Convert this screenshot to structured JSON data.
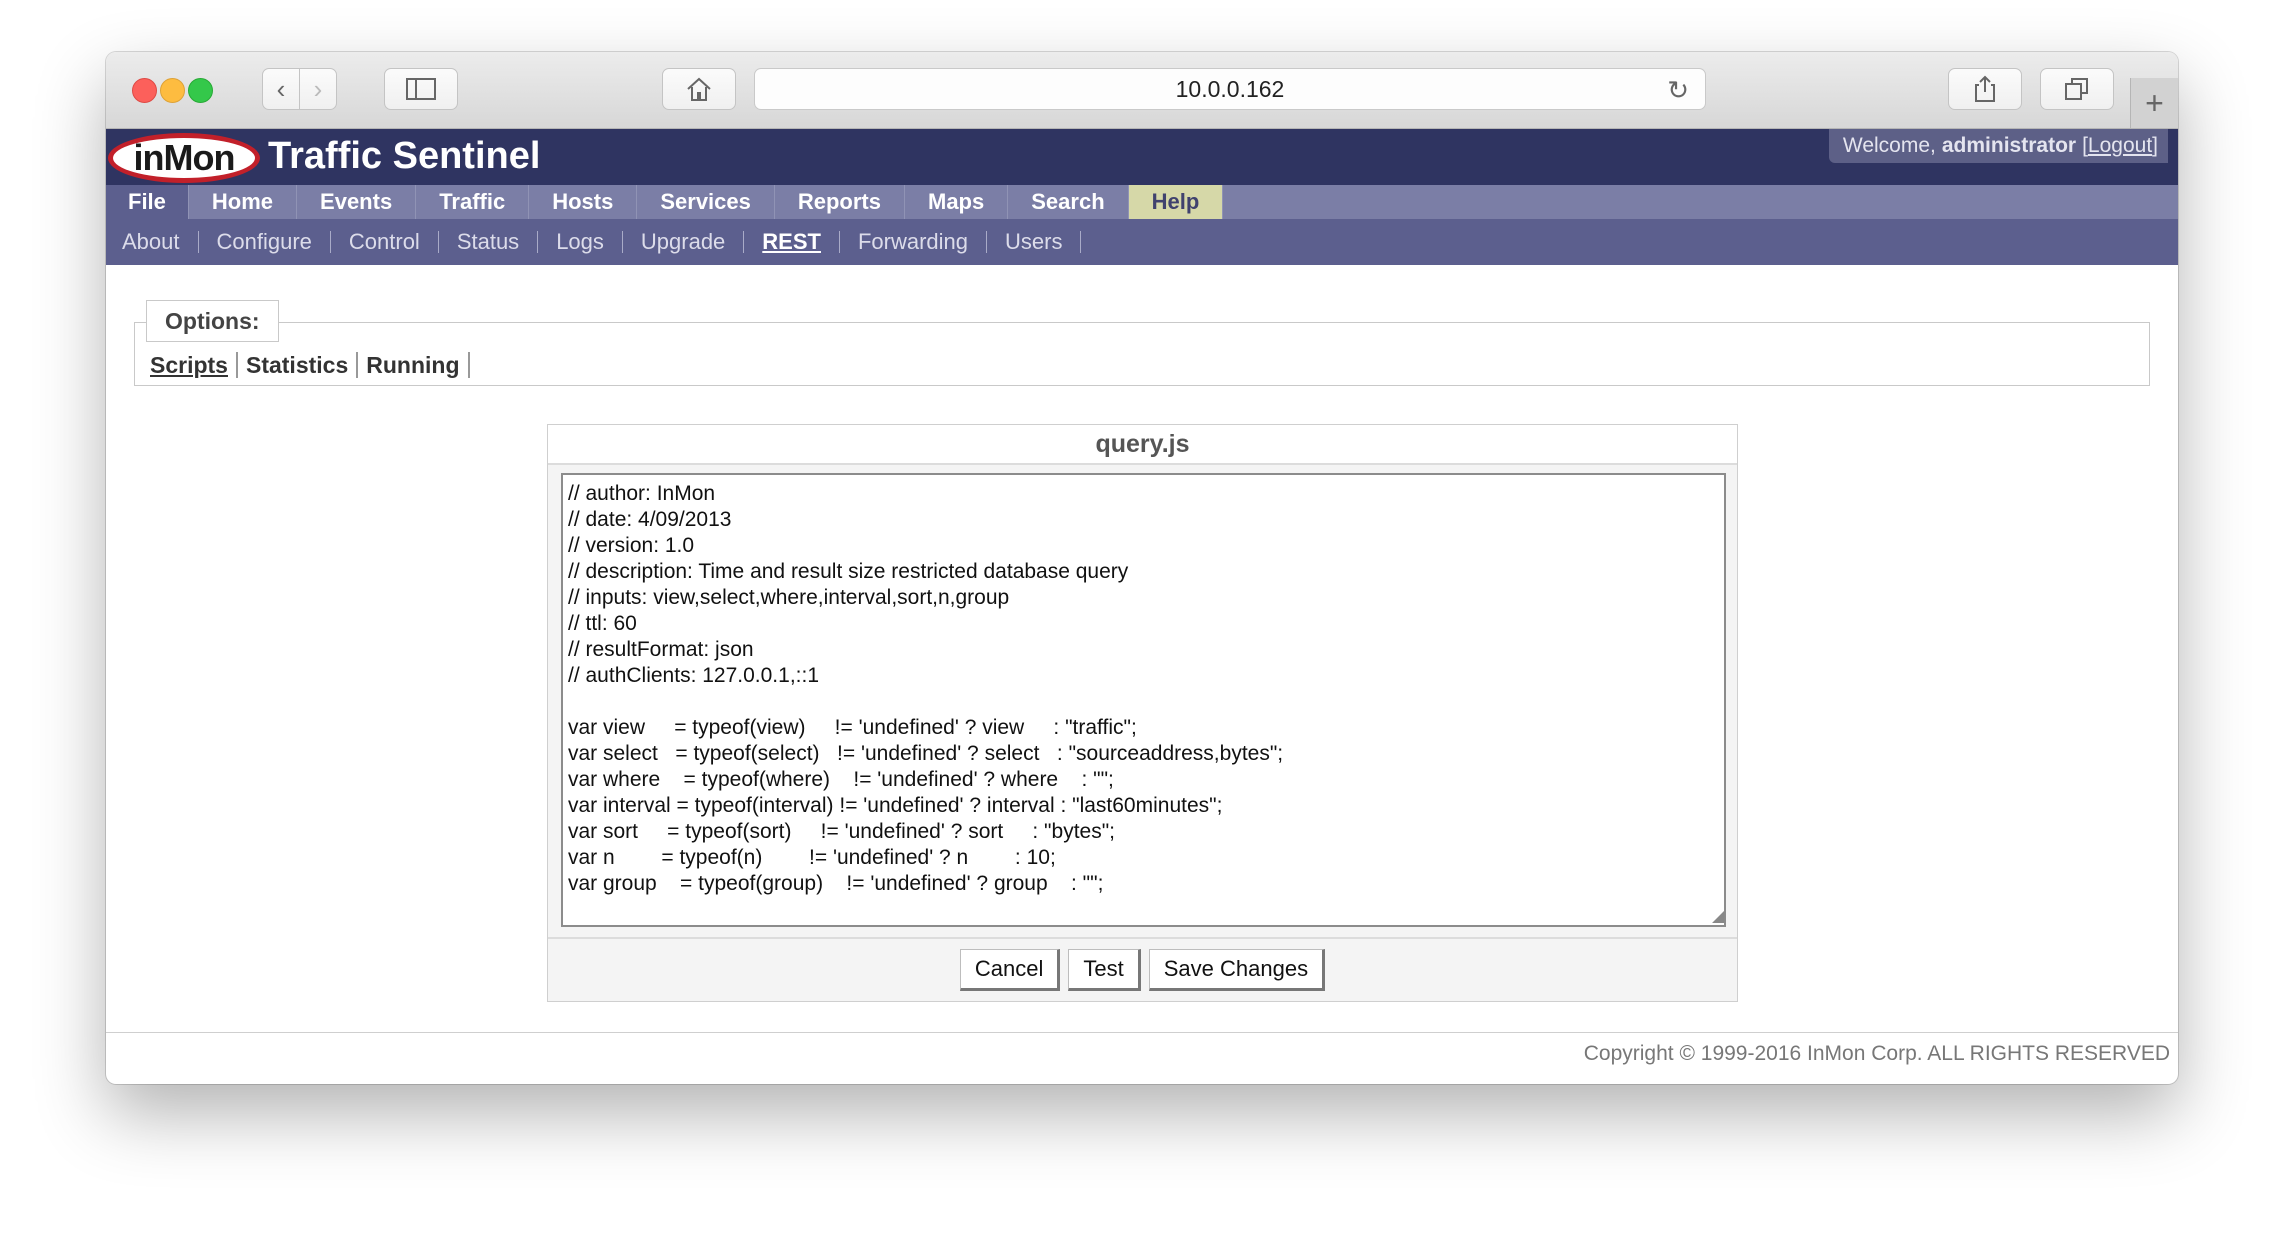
{
  "browser": {
    "address": "10.0.0.162",
    "icons": [
      "back-icon",
      "forward-icon",
      "sidebar-icon",
      "home-icon",
      "reload-icon",
      "share-icon",
      "tabs-icon",
      "new-tab-icon"
    ]
  },
  "header": {
    "logo_text": "inMon",
    "app_title": "Traffic Sentinel",
    "welcome_prefix": "Welcome,",
    "user": "administrator",
    "logout_open": "[",
    "logout": "Logout",
    "logout_close": "]"
  },
  "menu": {
    "items": [
      {
        "label": "File"
      },
      {
        "label": "Home"
      },
      {
        "label": "Events"
      },
      {
        "label": "Traffic"
      },
      {
        "label": "Hosts"
      },
      {
        "label": "Services"
      },
      {
        "label": "Reports"
      },
      {
        "label": "Maps"
      },
      {
        "label": "Search"
      },
      {
        "label": "Help"
      }
    ],
    "active": "File"
  },
  "submenu": {
    "items": [
      {
        "label": "About"
      },
      {
        "label": "Configure"
      },
      {
        "label": "Control"
      },
      {
        "label": "Status"
      },
      {
        "label": "Logs"
      },
      {
        "label": "Upgrade"
      },
      {
        "label": "REST"
      },
      {
        "label": "Forwarding"
      },
      {
        "label": "Users"
      }
    ],
    "active": "REST"
  },
  "options": {
    "legend": "Options:",
    "links": [
      {
        "label": "Scripts"
      },
      {
        "label": "Statistics"
      },
      {
        "label": "Running"
      }
    ],
    "active": "Scripts"
  },
  "editor": {
    "title": "query.js",
    "code": "// author: InMon\n// date: 4/09/2013\n// version: 1.0\n// description: Time and result size restricted database query\n// inputs: view,select,where,interval,sort,n,group\n// ttl: 60\n// resultFormat: json\n// authClients: 127.0.0.1,::1\n\nvar view     = typeof(view)     != 'undefined' ? view     : \"traffic\";\nvar select   = typeof(select)   != 'undefined' ? select   : \"sourceaddress,bytes\";\nvar where    = typeof(where)    != 'undefined' ? where    : \"\";\nvar interval = typeof(interval) != 'undefined' ? interval : \"last60minutes\";\nvar sort     = typeof(sort)     != 'undefined' ? sort     : \"bytes\";\nvar n        = typeof(n)        != 'undefined' ? n        : 10;\nvar group    = typeof(group)    != 'undefined' ? group    : \"\";",
    "buttons": {
      "cancel": "Cancel",
      "test": "Test",
      "save": "Save Changes"
    }
  },
  "footer": {
    "copyright": "Copyright © 1999-2016 InMon Corp. ALL RIGHTS RESERVED"
  },
  "colors": {
    "header_bg": "#2f3461",
    "menu_bg": "#7b7ea6",
    "submenu_bg": "#5c5f8e",
    "help_tab": "#d6d8a8",
    "logo_ring": "#c2202a"
  }
}
